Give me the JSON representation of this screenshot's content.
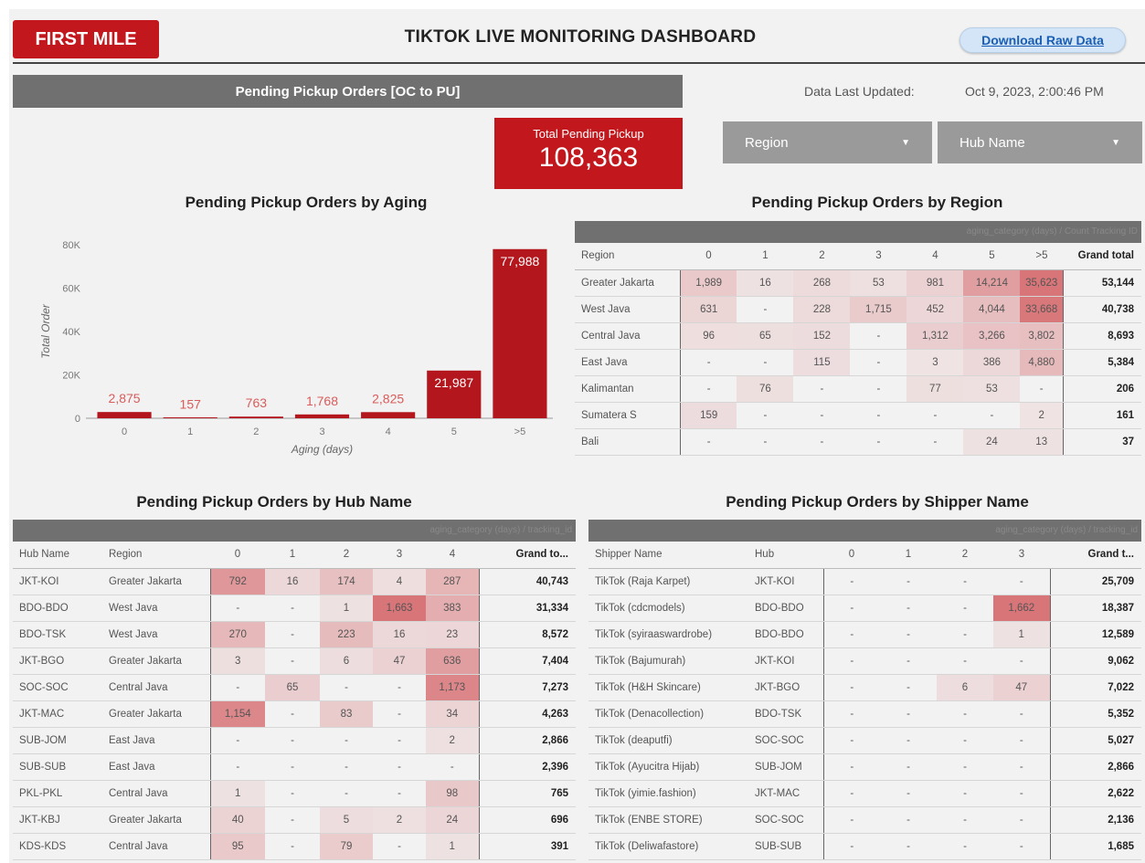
{
  "header": {
    "brand": "FIRST MILE",
    "title": "TIKTOK LIVE MONITORING DASHBOARD",
    "download_label": "Download Raw Data"
  },
  "section": {
    "title": "Pending Pickup Orders [OC to PU]"
  },
  "updated": {
    "label": "Data Last Updated:",
    "value": "Oct 9, 2023, 2:00:46 PM"
  },
  "kpi": {
    "label": "Total Pending Pickup",
    "value": "108,363"
  },
  "filters": {
    "region": "Region",
    "hub": "Hub Name"
  },
  "aging_chart": {
    "title": "Pending Pickup Orders by Aging",
    "chart_data": {
      "type": "bar",
      "categories": [
        "0",
        "1",
        "2",
        "3",
        "4",
        "5",
        ">5"
      ],
      "values": [
        2875,
        157,
        763,
        1768,
        2825,
        21987,
        77988
      ],
      "labels": [
        "2,875",
        "157",
        "763",
        "1,768",
        "2,825",
        "21,987",
        "77,988"
      ],
      "xlabel": "Aging (days)",
      "ylabel": "Total Order",
      "yticks": [
        "0",
        "20K",
        "40K",
        "60K",
        "80K"
      ],
      "ylim": [
        0,
        80000
      ],
      "bar_color": "#b3161c",
      "label_color": "#d95b5b"
    }
  },
  "region_table": {
    "title": "Pending Pickup Orders by Region",
    "header_note": "aging_category (days) / Count Tracking ID",
    "columns": [
      "Region",
      "0",
      "1",
      "2",
      "3",
      "4",
      "5",
      ">5",
      "Grand total"
    ],
    "rows": [
      [
        "Greater Jakarta",
        "1,989",
        "16",
        "268",
        "53",
        "981",
        "14,214",
        "35,623",
        "53,144"
      ],
      [
        "West Java",
        "631",
        "-",
        "228",
        "1,715",
        "452",
        "4,044",
        "33,668",
        "40,738"
      ],
      [
        "Central Java",
        "96",
        "65",
        "152",
        "-",
        "1,312",
        "3,266",
        "3,802",
        "8,693"
      ],
      [
        "East Java",
        "-",
        "-",
        "115",
        "-",
        "3",
        "386",
        "4,880",
        "5,384"
      ],
      [
        "Kalimantan",
        "-",
        "76",
        "-",
        "-",
        "77",
        "53",
        "-",
        "206"
      ],
      [
        "Sumatera S",
        "159",
        "-",
        "-",
        "-",
        "-",
        "-",
        "2",
        "161"
      ],
      [
        "Bali",
        "-",
        "-",
        "-",
        "-",
        "-",
        "24",
        "13",
        "37"
      ]
    ]
  },
  "hub_table": {
    "title": "Pending Pickup Orders by Hub Name",
    "header_note": "aging_category (days) / tracking_id",
    "columns": [
      "Hub Name",
      "Region",
      "0",
      "1",
      "2",
      "3",
      "4",
      "Grand to..."
    ],
    "rows": [
      [
        "JKT-KOI",
        "Greater Jakarta",
        "792",
        "16",
        "174",
        "4",
        "287",
        "40,743"
      ],
      [
        "BDO-BDO",
        "West Java",
        "-",
        "-",
        "1",
        "1,663",
        "383",
        "31,334"
      ],
      [
        "BDO-TSK",
        "West Java",
        "270",
        "-",
        "223",
        "16",
        "23",
        "8,572"
      ],
      [
        "JKT-BGO",
        "Greater Jakarta",
        "3",
        "-",
        "6",
        "47",
        "636",
        "7,404"
      ],
      [
        "SOC-SOC",
        "Central Java",
        "-",
        "65",
        "-",
        "-",
        "1,173",
        "7,273"
      ],
      [
        "JKT-MAC",
        "Greater Jakarta",
        "1,154",
        "-",
        "83",
        "-",
        "34",
        "4,263"
      ],
      [
        "SUB-JOM",
        "East Java",
        "-",
        "-",
        "-",
        "-",
        "2",
        "2,866"
      ],
      [
        "SUB-SUB",
        "East Java",
        "-",
        "-",
        "-",
        "-",
        "-",
        "2,396"
      ],
      [
        "PKL-PKL",
        "Central Java",
        "1",
        "-",
        "-",
        "-",
        "98",
        "765"
      ],
      [
        "JKT-KBJ",
        "Greater Jakarta",
        "40",
        "-",
        "5",
        "2",
        "24",
        "696"
      ],
      [
        "KDS-KDS",
        "Central Java",
        "95",
        "-",
        "79",
        "-",
        "1",
        "391"
      ]
    ]
  },
  "shipper_table": {
    "title": "Pending Pickup Orders by Shipper Name",
    "header_note": "aging_category (days) / tracking_id",
    "columns": [
      "Shipper Name",
      "Hub",
      "0",
      "1",
      "2",
      "3",
      "Grand t..."
    ],
    "rows": [
      [
        "TikTok (Raja Karpet)",
        "JKT-KOI",
        "-",
        "-",
        "-",
        "-",
        "25,709"
      ],
      [
        "TikTok (cdcmodels)",
        "BDO-BDO",
        "-",
        "-",
        "-",
        "1,662",
        "18,387"
      ],
      [
        "TikTok (syiraaswardrobe)",
        "BDO-BDO",
        "-",
        "-",
        "-",
        "1",
        "12,589"
      ],
      [
        "TikTok (Bajumurah)",
        "JKT-KOI",
        "-",
        "-",
        "-",
        "-",
        "9,062"
      ],
      [
        "TikTok (H&H Skincare)",
        "JKT-BGO",
        "-",
        "-",
        "6",
        "47",
        "7,022"
      ],
      [
        "TikTok (Denacollection)",
        "BDO-TSK",
        "-",
        "-",
        "-",
        "-",
        "5,352"
      ],
      [
        "TikTok (deaputfi)",
        "SOC-SOC",
        "-",
        "-",
        "-",
        "-",
        "5,027"
      ],
      [
        "TikTok (Ayucitra Hijab)",
        "SUB-JOM",
        "-",
        "-",
        "-",
        "-",
        "2,866"
      ],
      [
        "TikTok (yimie.fashion)",
        "JKT-MAC",
        "-",
        "-",
        "-",
        "-",
        "2,622"
      ],
      [
        "TikTok (ENBE STORE)",
        "SOC-SOC",
        "-",
        "-",
        "-",
        "-",
        "2,136"
      ],
      [
        "TikTok (Deliwafastore)",
        "SUB-SUB",
        "-",
        "-",
        "-",
        "-",
        "1,685"
      ]
    ]
  },
  "colors": {
    "brand_red": "#c2171d",
    "header_gray": "#707070",
    "filter_gray": "#9a9a9a",
    "link_blue": "#1a5fb4"
  }
}
